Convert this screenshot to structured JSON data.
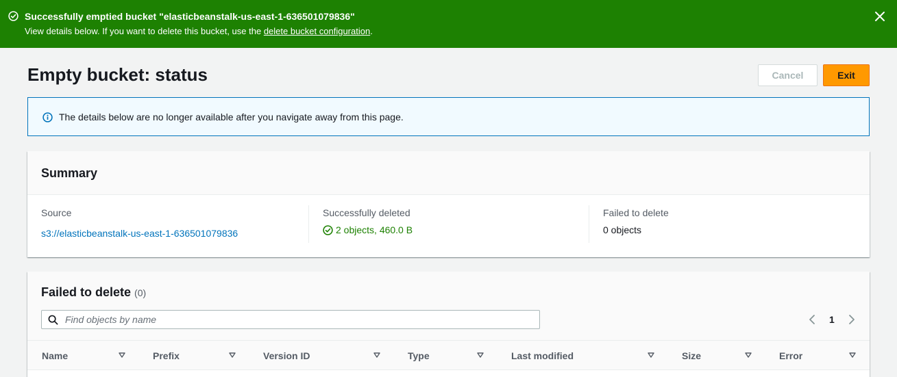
{
  "flash": {
    "title": "Successfully emptied bucket \"elasticbeanstalk-us-east-1-636501079836\"",
    "desc_before": "View details below. If you want to delete this bucket, use the ",
    "link": "delete bucket configuration",
    "desc_after": ".",
    "color": "#1d8102",
    "icon": "check-circle-icon",
    "close_icon": "close-icon"
  },
  "page": {
    "title": "Empty bucket: status",
    "cancel_label": "Cancel",
    "exit_label": "Exit",
    "accent": "#ff9900"
  },
  "info": {
    "text": "The details below are no longer available after you navigate away from this page.",
    "icon": "info-icon"
  },
  "summary": {
    "title": "Summary",
    "source_label": "Source",
    "source_value": "s3://elasticbeanstalk-us-east-1-636501079836",
    "deleted_label": "Successfully deleted",
    "deleted_value": "2 objects, 460.0 B",
    "failed_label": "Failed to delete",
    "failed_value": "0 objects"
  },
  "failed_table": {
    "title": "Failed to delete",
    "count": "(0)",
    "search_placeholder": "Find objects by name",
    "page": "1",
    "columns": [
      "Name",
      "Prefix",
      "Version ID",
      "Type",
      "Last modified",
      "Size",
      "Error"
    ]
  }
}
